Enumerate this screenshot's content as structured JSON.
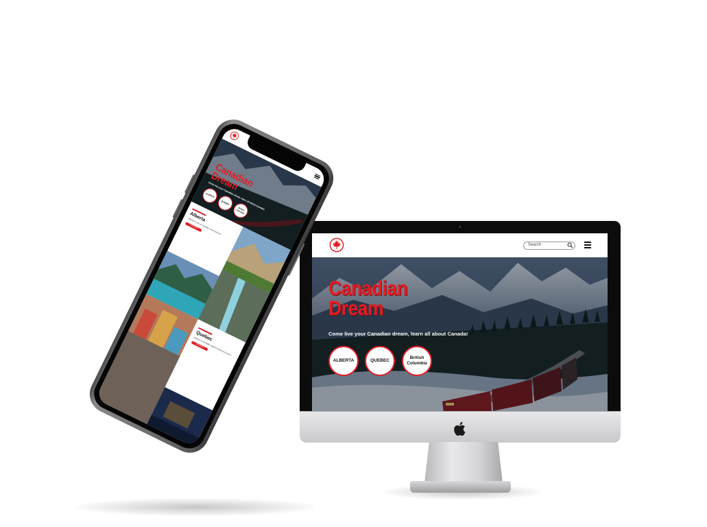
{
  "colors": {
    "brand_red": "#e21d25",
    "header_bg": "#ffffff",
    "device_black": "#0c0c0c",
    "aluminum": "#d8d8da"
  },
  "icons": {
    "logo": "maple-leaf-icon",
    "search": "search-icon",
    "menu": "hamburger-menu-icon",
    "device_brand": "apple-logo-icon"
  },
  "desktop": {
    "search": {
      "placeholder": "Search"
    },
    "hero": {
      "title_line1": "Canadian",
      "title_line2": "Dream",
      "subtitle": "Come live your Canadian dream, learn all about Canada!"
    },
    "regions": [
      {
        "label": "ALBERTA"
      },
      {
        "label": "QUEBEC"
      },
      {
        "label_line1": "British",
        "label_line2": "Columbia"
      }
    ]
  },
  "mobile": {
    "hero": {
      "title_line1": "Canadian",
      "title_line2": "Dream",
      "subtitle": "Come live your Canadian dream, learn all about Canada!"
    },
    "regions": [
      {
        "label": "ALBERTA"
      },
      {
        "label": "QUEBEC"
      },
      {
        "label_line1": "British",
        "label_line2": "Columbia"
      }
    ],
    "sections": [
      {
        "heading": "Alberta",
        "lead": "Alberta is one of Canada's ten provinces",
        "button": "Learn more"
      },
      {
        "heading": "Quebec",
        "lead": "Quebec is Canada's largest province by area",
        "button": "Learn more"
      }
    ]
  }
}
